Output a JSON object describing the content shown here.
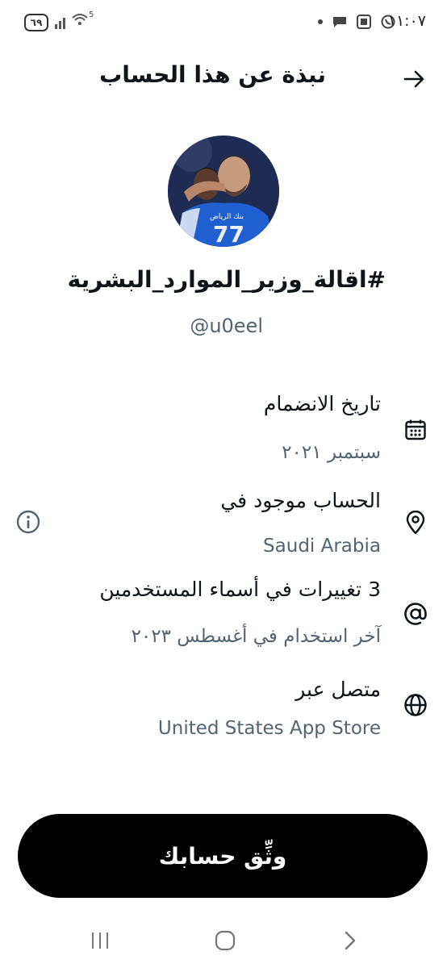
{
  "status_bar": {
    "time": "١١:٠٧",
    "battery": "٦٩",
    "wifi_label": "5"
  },
  "header": {
    "title": "نبذة عن هذا الحساب"
  },
  "profile": {
    "display_name": "#اقالة_وزير_الموارد_البشرية",
    "username": "@u0eel",
    "jersey_sponsor": "بنك الرياض",
    "jersey_number": "77"
  },
  "rows": [
    {
      "title": "تاريخ الانضمام",
      "value": "سبتمبر ٢٠٢١",
      "icon": "calendar-icon"
    },
    {
      "title": "الحساب موجود في",
      "value": "Saudi Arabia",
      "icon": "location-pin-icon"
    },
    {
      "title": "3 تغييرات في أسماء المستخدمين",
      "value": "آخر استخدام في أغسطس ٢٠٢٣",
      "icon": "at-sign-icon"
    },
    {
      "title": "متصل عبر",
      "value": "United States App Store",
      "icon": "globe-icon"
    }
  ],
  "verify_button": {
    "label": "وثِّق حسابك"
  }
}
